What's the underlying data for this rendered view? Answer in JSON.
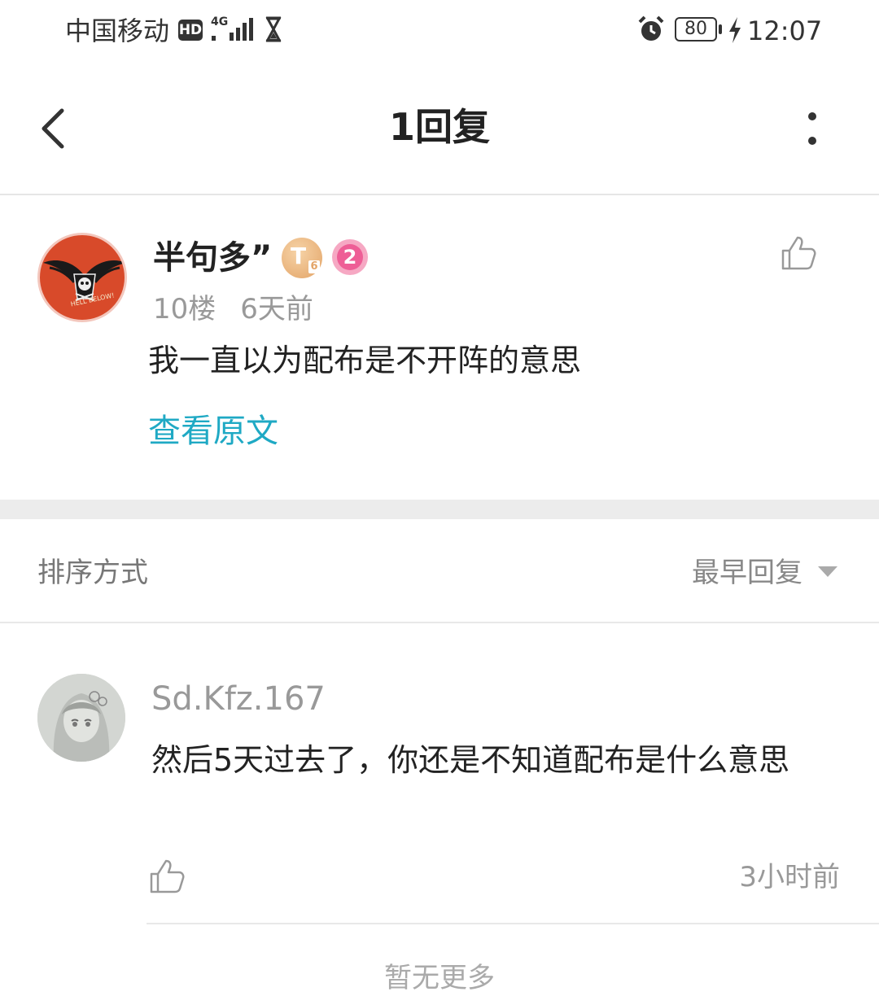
{
  "status_bar": {
    "carrier": "中国移动",
    "hd_badge": "HD",
    "network": "4G",
    "battery": "80",
    "time": "12:07"
  },
  "nav": {
    "title": "1回复",
    "back_icon": "chevron-left-icon",
    "more_icon": "more-vertical-icon"
  },
  "post": {
    "author": "半句多”",
    "level_badge": "T",
    "level_sub": "6",
    "rank_badge": "2",
    "floor": "10楼",
    "time": "6天前",
    "content": "我一直以为配布是不开阵的意思",
    "view_original": "查看原文",
    "avatar_text": "HELL BELOW!",
    "accent_color": "#1fa9c4"
  },
  "sort": {
    "label": "排序方式",
    "value": "最早回复"
  },
  "reply": {
    "author": "Sd.Kfz.167",
    "content": "然后5天过去了，你还是不知道配布是什么意思",
    "time": "3小时前"
  },
  "footer": {
    "load_more": "暂无更多"
  }
}
